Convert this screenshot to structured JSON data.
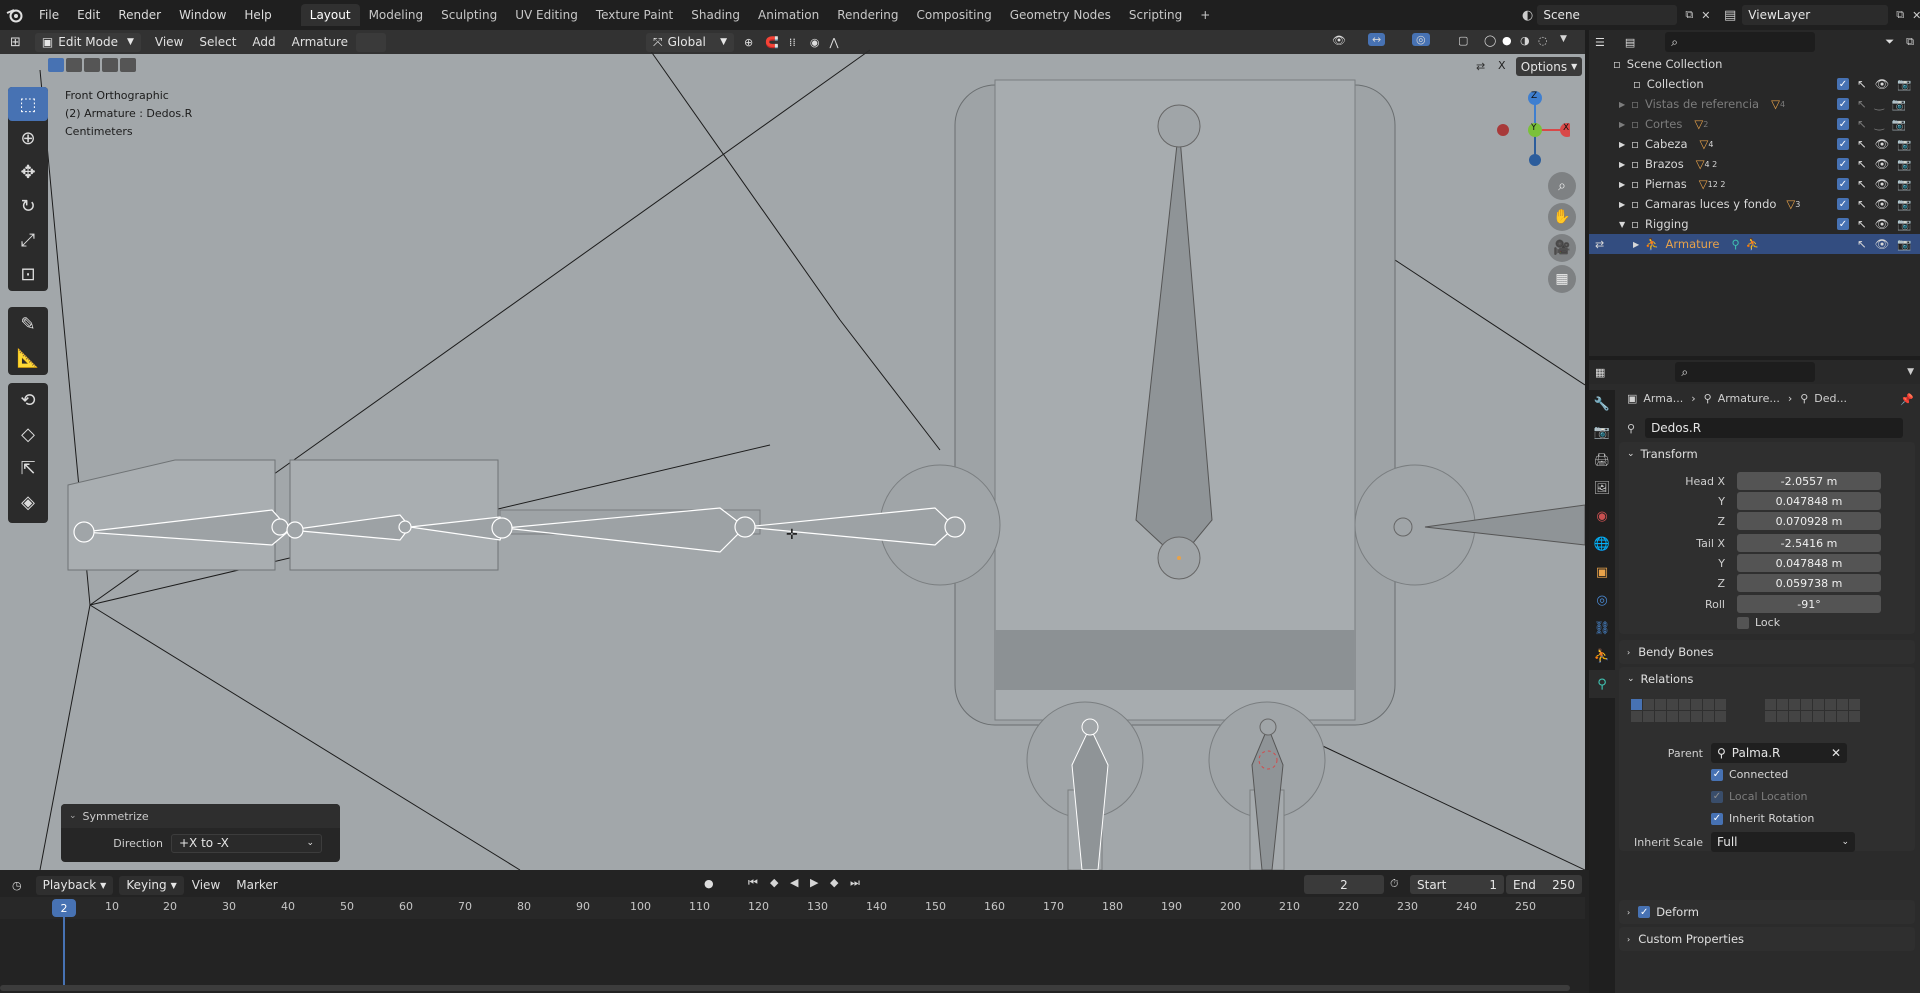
{
  "topbar": {
    "menus": [
      "File",
      "Edit",
      "Render",
      "Window",
      "Help"
    ],
    "workspaces": [
      "Layout",
      "Modeling",
      "Sculpting",
      "UV Editing",
      "Texture Paint",
      "Shading",
      "Animation",
      "Rendering",
      "Compositing",
      "Geometry Nodes",
      "Scripting"
    ],
    "active_workspace": "Layout",
    "add_tab": "+",
    "scene": "Scene",
    "view_layer": "ViewLayer"
  },
  "viewport_header": {
    "mode": "Edit Mode",
    "menus": [
      "View",
      "Select",
      "Add",
      "Armature"
    ],
    "orientation": "Global",
    "options_label": "Options",
    "close_label": "X"
  },
  "viewport_info": {
    "view": "Front Orthographic",
    "object": "(2) Armature : Dedos.R",
    "units": "Centimeters"
  },
  "gizmo": {
    "x": "X",
    "y": "Y",
    "z": "Z"
  },
  "symmetrize": {
    "title": "Symmetrize",
    "direction_label": "Direction",
    "direction_value": "+X to -X"
  },
  "outliner": {
    "root": "Scene Collection",
    "rows": [
      {
        "label": "Collection",
        "dim": false,
        "badge": ""
      },
      {
        "label": "Vistas de referencia",
        "dim": true,
        "badge": "4"
      },
      {
        "label": "Cortes",
        "dim": true,
        "badge": "2"
      },
      {
        "label": "Cabeza",
        "dim": false,
        "badge": "4"
      },
      {
        "label": "Brazos",
        "dim": false,
        "badge": "4 2"
      },
      {
        "label": "Piernas",
        "dim": false,
        "badge": "12 2"
      },
      {
        "label": "Camaras luces y fondo",
        "dim": false,
        "badge": "3"
      },
      {
        "label": "Rigging",
        "dim": false,
        "badge": ""
      },
      {
        "label": "Armature",
        "dim": false,
        "badge": ""
      }
    ]
  },
  "properties": {
    "breadcrumb": [
      "Arma...",
      "Armature...",
      "Ded..."
    ],
    "bone_name": "Dedos.R",
    "transform_title": "Transform",
    "head_x_label": "Head X",
    "head_x": "-2.0557 m",
    "head_y_label": "Y",
    "head_y": "0.047848 m",
    "head_z_label": "Z",
    "head_z": "0.070928 m",
    "tail_x_label": "Tail X",
    "tail_x": "-2.5416 m",
    "tail_y_label": "Y",
    "tail_y": "0.047848 m",
    "tail_z_label": "Z",
    "tail_z": "0.059738 m",
    "roll_label": "Roll",
    "roll": "-91°",
    "lock_label": "Lock",
    "bendy_title": "Bendy Bones",
    "relations_title": "Relations",
    "parent_label": "Parent",
    "parent_value": "Palma.R",
    "connected_label": "Connected",
    "local_location_label": "Local Location",
    "inherit_rotation_label": "Inherit Rotation",
    "inherit_scale_label": "Inherit Scale",
    "inherit_scale_value": "Full",
    "deform_title": "Deform",
    "custom_title": "Custom Properties"
  },
  "timeline": {
    "menus": [
      "Playback",
      "Keying",
      "View",
      "Marker"
    ],
    "current_frame": "2",
    "start_label": "Start",
    "start": "1",
    "end_label": "End",
    "end": "250",
    "ticks": [
      "2",
      "10",
      "20",
      "30",
      "40",
      "50",
      "60",
      "70",
      "80",
      "90",
      "100",
      "110",
      "120",
      "130",
      "140",
      "150",
      "160",
      "170",
      "180",
      "190",
      "200",
      "210",
      "220",
      "230",
      "240",
      "250"
    ]
  },
  "colors": {
    "accent": "#4772b3",
    "viewport_bg": "#a2a7aa",
    "panel_bg": "#2b2b2b",
    "selected_row": "#334d80",
    "bone_orange": "#e8a24a"
  }
}
